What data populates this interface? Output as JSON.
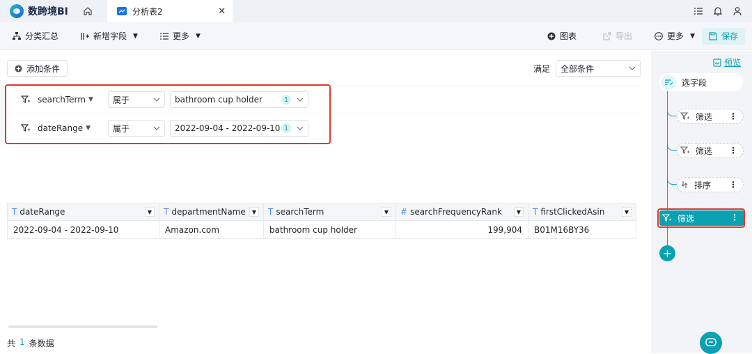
{
  "app": {
    "name": "数跨境BI"
  },
  "tab": {
    "label": "分析表2"
  },
  "toolbar": {
    "group_by": "分类汇总",
    "new_field": "新增字段",
    "more_left": "更多",
    "chart": "图表",
    "export": "导出",
    "more_right": "更多",
    "save": "保存"
  },
  "filters": {
    "add_label": "添加条件",
    "satisfy_label": "满足",
    "satisfy_value": "全部条件",
    "rows": [
      {
        "field": "searchTerm",
        "op": "属于",
        "value": "bathroom cup holder",
        "count": "1"
      },
      {
        "field": "dateRange",
        "op": "属于",
        "value": "2022-09-04 - 2022-09-10",
        "count": "1"
      }
    ]
  },
  "table": {
    "columns": [
      {
        "name": "dateRange",
        "type": "T"
      },
      {
        "name": "departmentName",
        "type": "T"
      },
      {
        "name": "searchTerm",
        "type": "T"
      },
      {
        "name": "searchFrequencyRank",
        "type": "#"
      },
      {
        "name": "firstClickedAsin",
        "type": "T"
      }
    ],
    "rows": [
      [
        "2022-09-04 - 2022-09-10",
        "Amazon.com",
        "bathroom cup holder",
        "199,904",
        "B01M16BY36"
      ]
    ]
  },
  "footer": {
    "prefix": "共",
    "count": "1",
    "suffix": "条数据"
  },
  "sidebar": {
    "preview": "预览",
    "select_fields": "选字段",
    "steps": [
      {
        "label": "筛选",
        "icon": "filter-icon"
      },
      {
        "label": "筛选",
        "icon": "filter-icon"
      },
      {
        "label": "排序",
        "icon": "sort-icon"
      },
      {
        "label": "筛选",
        "icon": "filter-icon",
        "active": true
      }
    ],
    "add": "+"
  },
  "colors": {
    "accent": "#0AA1B3",
    "highlight": "#E0392E"
  }
}
